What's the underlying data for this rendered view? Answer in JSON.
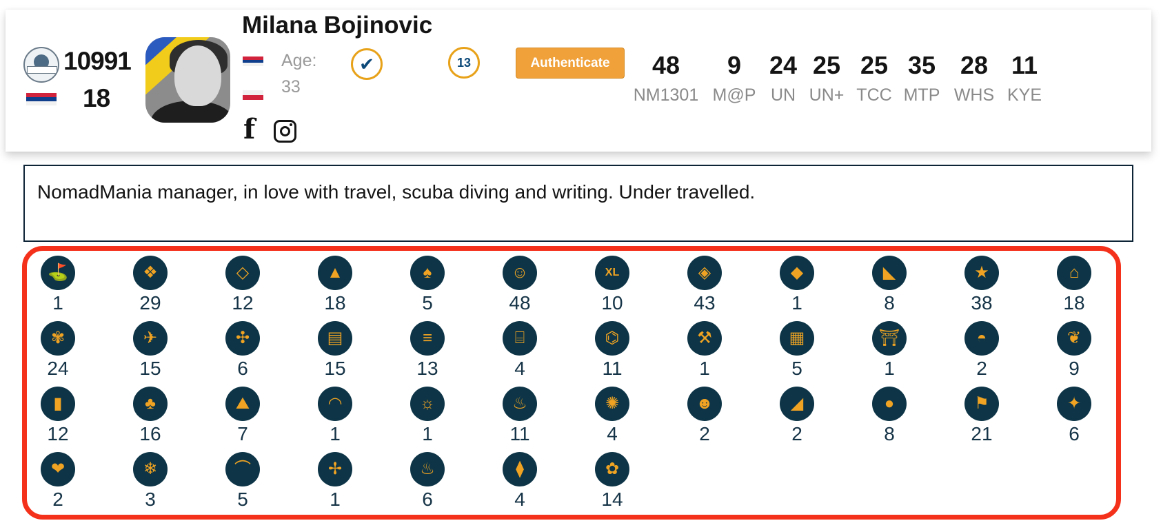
{
  "profile": {
    "name": "Milana Bojinovic",
    "rank": "10991",
    "rank_secondary": "18",
    "age_label": "Age:",
    "age_value": "33",
    "level_badge": "13",
    "authenticate_label": "Authenticate",
    "check_glyph": "✔",
    "facebook_glyph": "f"
  },
  "stats": [
    {
      "value": "48",
      "label": "NM1301"
    },
    {
      "value": "9",
      "label": "M@P"
    },
    {
      "value": "24",
      "label": "UN"
    },
    {
      "value": "25",
      "label": "UN+"
    },
    {
      "value": "25",
      "label": "TCC"
    },
    {
      "value": "35",
      "label": "MTP"
    },
    {
      "value": "28",
      "label": "WHS"
    },
    {
      "value": "11",
      "label": "KYE"
    }
  ],
  "bio": "NomadMania manager, in love with travel, scuba diving and writing. Under travelled.",
  "colors": {
    "accent": "#f0a13a",
    "badge_bg": "#0d3547",
    "badge_fg": "#f0a322",
    "highlight": "#f4311b"
  },
  "badges": [
    {
      "icon": "golf-flag-icon",
      "glyph": "⛳",
      "count": "1"
    },
    {
      "icon": "heritage-site-icon",
      "glyph": "❖",
      "count": "29"
    },
    {
      "icon": "heritage-outline-icon",
      "glyph": "◇",
      "count": "12"
    },
    {
      "icon": "observatory-icon",
      "glyph": "▲",
      "count": "18"
    },
    {
      "icon": "island-palm-icon",
      "glyph": "♠",
      "count": "5"
    },
    {
      "icon": "person-icon",
      "glyph": "☺",
      "count": "48"
    },
    {
      "icon": "xl-icon",
      "glyph": "XL",
      "count": "10"
    },
    {
      "icon": "europe-map-icon",
      "glyph": "◈",
      "count": "43"
    },
    {
      "icon": "africa-map-icon",
      "glyph": "◆",
      "count": "1"
    },
    {
      "icon": "asia-map-icon",
      "glyph": "◣",
      "count": "8"
    },
    {
      "icon": "star-icon",
      "glyph": "★",
      "count": "38"
    },
    {
      "icon": "house-icon",
      "glyph": "⌂",
      "count": "18"
    },
    {
      "icon": "tree-icon",
      "glyph": "✾",
      "count": "24"
    },
    {
      "icon": "airplane-icon",
      "glyph": "✈",
      "count": "15"
    },
    {
      "icon": "flight-path-icon",
      "glyph": "✣",
      "count": "6"
    },
    {
      "icon": "train-icon",
      "glyph": "▤",
      "count": "15"
    },
    {
      "icon": "road-icon",
      "glyph": "≡",
      "count": "13"
    },
    {
      "icon": "museum-icon",
      "glyph": "⌸",
      "count": "4"
    },
    {
      "icon": "church-icon",
      "glyph": "⌬",
      "count": "11"
    },
    {
      "icon": "crossed-tools-icon",
      "glyph": "⚒",
      "count": "1"
    },
    {
      "icon": "skyscraper-icon",
      "glyph": "▦",
      "count": "5"
    },
    {
      "icon": "shrine-icon",
      "glyph": "⛩",
      "count": "1"
    },
    {
      "icon": "dome-icon",
      "glyph": "◓",
      "count": "2"
    },
    {
      "icon": "plant-icon",
      "glyph": "❦",
      "count": "9"
    },
    {
      "icon": "obelisk-icon",
      "glyph": "▮",
      "count": "12"
    },
    {
      "icon": "oak-tree-icon",
      "glyph": "♣",
      "count": "16"
    },
    {
      "icon": "canyon-icon",
      "glyph": "⛰",
      "count": "7"
    },
    {
      "icon": "cave-icon",
      "glyph": "◠",
      "count": "1"
    },
    {
      "icon": "desert-icon",
      "glyph": "☼",
      "count": "1"
    },
    {
      "icon": "volcano-icon",
      "glyph": "♨",
      "count": "11"
    },
    {
      "icon": "fireworks-icon",
      "glyph": "✺",
      "count": "4"
    },
    {
      "icon": "monkey-icon",
      "glyph": "☻",
      "count": "2"
    },
    {
      "icon": "cocktail-icon",
      "glyph": "◢",
      "count": "2"
    },
    {
      "icon": "sun-icon",
      "glyph": "●",
      "count": "8"
    },
    {
      "icon": "flag-icon",
      "glyph": "⚑",
      "count": "21"
    },
    {
      "icon": "price-tag-icon",
      "glyph": "✦",
      "count": "6"
    },
    {
      "icon": "apple-icon",
      "glyph": "❤",
      "count": "2"
    },
    {
      "icon": "snowflake-icon",
      "glyph": "❄",
      "count": "3"
    },
    {
      "icon": "bridge-icon",
      "glyph": "⌒",
      "count": "5"
    },
    {
      "icon": "windmill-icon",
      "glyph": "✢",
      "count": "1"
    },
    {
      "icon": "pumpkin-icon",
      "glyph": "♨",
      "count": "6"
    },
    {
      "icon": "cable-car-icon",
      "glyph": "⧫",
      "count": "4"
    },
    {
      "icon": "chef-icon",
      "glyph": "✿",
      "count": "14"
    }
  ]
}
